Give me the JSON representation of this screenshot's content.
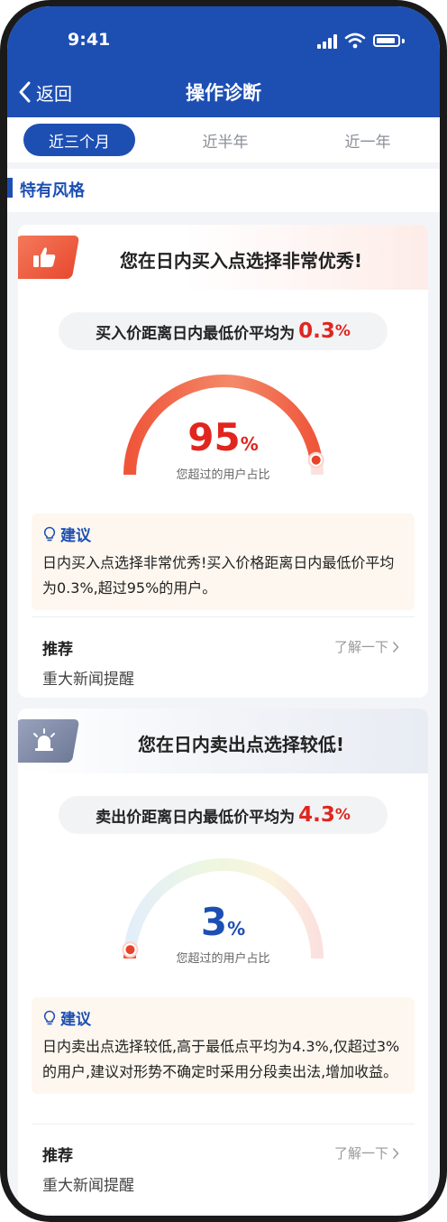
{
  "status": {
    "time": "9:41"
  },
  "nav": {
    "back_label": "返回",
    "title": "操作诊断"
  },
  "tabs": [
    {
      "label": "近三个月",
      "active": true
    },
    {
      "label": "近半年",
      "active": false
    },
    {
      "label": "近一年",
      "active": false
    }
  ],
  "section": {
    "title": "特有风格"
  },
  "cards": [
    {
      "title": "您在日内买入点选择非常优秀!",
      "badge_icon": "thumbs-up-icon",
      "metric_label": "买入价距离日内最低价平均为",
      "metric_value": "0.3",
      "metric_unit": "%",
      "gauge_value": "95",
      "gauge_unit": "%",
      "gauge_percent": 95,
      "gauge_caption": "您超过的用户占比",
      "advice_title": "建议",
      "advice_text": "日内买入点选择非常优秀!买入价格距离日内最低价平均为0.3%,超过95%的用户。",
      "rec_label": "推荐",
      "rec_link": "了解一下",
      "rec_item": "重大新闻提醒"
    },
    {
      "title": "您在日内卖出点选择较低!",
      "badge_icon": "alarm-light-icon",
      "metric_label": "卖出价距离日内最低价平均为",
      "metric_value": "4.3",
      "metric_unit": "%",
      "gauge_value": "3",
      "gauge_unit": "%",
      "gauge_percent": 3,
      "gauge_caption": "您超过的用户占比",
      "advice_title": "建议",
      "advice_text": "日内卖出点选择较低,高于最低点平均为4.3%,仅超过3%的用户,建议对形势不确定时采用分段卖出法,增加收益。",
      "rec_label": "推荐",
      "rec_link": "了解一下",
      "rec_item": "重大新闻提醒"
    }
  ],
  "colors": {
    "brand_blue": "#1d4fb3",
    "highlight_red": "#e0261f",
    "good_badge": "#f0553a",
    "bad_badge": "#7a86a6"
  }
}
